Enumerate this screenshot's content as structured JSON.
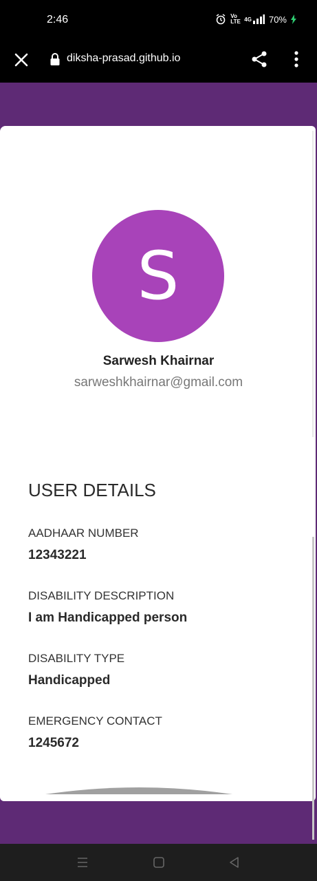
{
  "status_bar": {
    "time": "2:46",
    "volte_label": "Vo LTE",
    "network_label": "4G",
    "battery": "70%"
  },
  "browser": {
    "url": "diksha-prasad.github.io"
  },
  "profile": {
    "avatar_letter": "S",
    "avatar_color": "#a843b9",
    "name": "Sarwesh Khairnar",
    "email": "sarweshkhairnar@gmail.com"
  },
  "details": {
    "title": "USER DETAILS",
    "fields": [
      {
        "label": "AADHAAR NUMBER",
        "value": "12343221"
      },
      {
        "label": "DISABILITY DESCRIPTION",
        "value": "I am Handicapped person"
      },
      {
        "label": "DISABILITY TYPE",
        "value": "Handicapped"
      },
      {
        "label": "EMERGENCY CONTACT",
        "value": "1245672"
      }
    ]
  },
  "theme": {
    "page_background": "#5e2a75",
    "card_background": "#ffffff"
  },
  "nav": {
    "icons": [
      "menu-icon",
      "home-icon",
      "back-icon"
    ]
  }
}
